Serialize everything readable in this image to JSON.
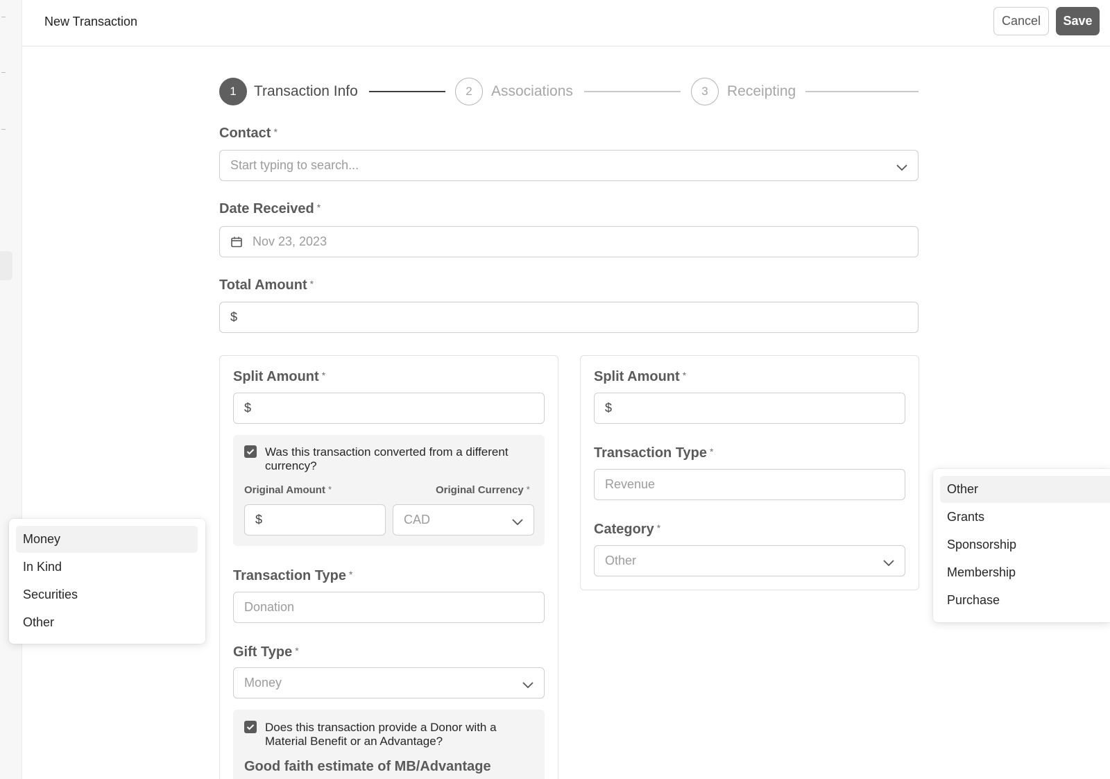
{
  "header": {
    "title": "New Transaction",
    "cancel_label": "Cancel",
    "save_label": "Save"
  },
  "stepper": {
    "steps": [
      {
        "number": "1",
        "label": "Transaction Info",
        "state": "active"
      },
      {
        "number": "2",
        "label": "Associations",
        "state": "inactive"
      },
      {
        "number": "3",
        "label": "Receipting",
        "state": "inactive"
      }
    ]
  },
  "form": {
    "required_mark": "*",
    "contact": {
      "label": "Contact",
      "placeholder": "Start typing to search..."
    },
    "date_received": {
      "label": "Date Received",
      "value": "Nov 23, 2023"
    },
    "total_amount": {
      "label": "Total Amount",
      "prefix": "$"
    }
  },
  "split_left": {
    "split_amount": {
      "label": "Split Amount",
      "prefix": "$"
    },
    "currency_question": {
      "text": "Was this transaction converted from a different currency?",
      "checked": true
    },
    "original_amount": {
      "label": "Original Amount",
      "prefix": "$"
    },
    "original_currency": {
      "label": "Original Currency",
      "value": "CAD"
    },
    "transaction_type": {
      "label": "Transaction Type",
      "value": "Donation"
    },
    "gift_type": {
      "label": "Gift Type",
      "value": "Money"
    },
    "advantage_question": {
      "text": "Does this transaction provide a Donor with a Material Benefit or an Advantage?",
      "checked": true
    },
    "good_faith_heading": "Good faith estimate of MB/Advantage"
  },
  "split_right": {
    "split_amount": {
      "label": "Split Amount",
      "prefix": "$"
    },
    "transaction_type": {
      "label": "Transaction Type",
      "value": "Revenue"
    },
    "category": {
      "label": "Category",
      "value": "Other"
    }
  },
  "gift_type_dropdown": {
    "options": [
      "Money",
      "In Kind",
      "Securities",
      "Other"
    ],
    "selected": "Money"
  },
  "category_dropdown": {
    "options": [
      "Other",
      "Grants",
      "Sponsorship",
      "Membership",
      "Purchase"
    ],
    "selected": "Other"
  },
  "icons": {
    "chevron": "chevron-down-icon",
    "calendar": "calendar-icon",
    "check": "checkmark-icon"
  },
  "colors": {
    "primary": "#5f5f5f",
    "border": "#cfcfcf",
    "muted_text": "#a7a7a7",
    "selected_bg": "#f2f2f2"
  }
}
